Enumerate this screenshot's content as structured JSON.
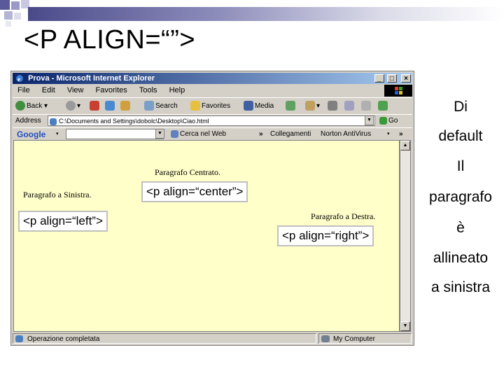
{
  "slide": {
    "title": "<P ALIGN=“”>",
    "accent_color": "#4a4a8a"
  },
  "browser": {
    "window_title": "Prova - Microsoft Internet Explorer",
    "window_buttons": [
      "_",
      "□",
      "×"
    ],
    "menu": [
      "File",
      "Edit",
      "View",
      "Favorites",
      "Tools",
      "Help"
    ],
    "toolbar": {
      "back": "Back",
      "search": "Search",
      "favorites": "Favorites",
      "media": "Media"
    },
    "address": {
      "label": "Address",
      "value": "C:\\Documents and Settings\\dobolc\\Desktop\\Ciao.html",
      "go": "Go"
    },
    "google_bar": {
      "logo": "Google",
      "search_web": "Cerca nel Web",
      "links": "Collegamenti",
      "antivirus": "Norton AntiVirus"
    },
    "content": {
      "background": "#ffffc9",
      "p_center": "Paragrafo Centrato.",
      "p_left": "Paragrafo a Sinistra.",
      "p_right": "Paragrafo a Destra."
    },
    "status": {
      "left": "Operazione completata",
      "right": "My Computer"
    }
  },
  "callouts": {
    "center": "<p align=“center”>",
    "left": "<p align=“left”>",
    "right": "<p align=“right”>"
  },
  "sidebar_text": [
    "Di",
    "default",
    "Il",
    "paragrafo",
    "è",
    "allineato",
    "a sinistra"
  ]
}
